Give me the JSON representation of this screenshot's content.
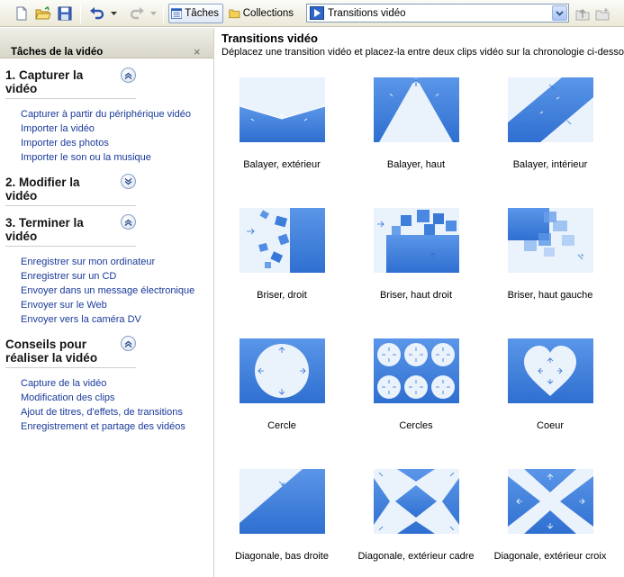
{
  "toolbar": {
    "tasks_label": "Tâches",
    "collections_label": "Collections",
    "combo_value": "Transitions vidéo"
  },
  "task_pane": {
    "title": "Tâches de la vidéo",
    "close": "×",
    "sections": [
      {
        "title_line1": "1. Capturer la",
        "title_line2": "vidéo",
        "state": "expanded",
        "links": [
          "Capturer à partir du périphérique vidéo",
          "Importer la vidéo",
          "Importer des photos",
          "Importer le son ou la musique"
        ]
      },
      {
        "title_line1": "2. Modifier la",
        "title_line2": "vidéo",
        "state": "collapsed",
        "links": []
      },
      {
        "title_line1": "3. Terminer la",
        "title_line2": "vidéo",
        "state": "expanded",
        "links": [
          "Enregistrer sur mon ordinateur",
          "Enregistrer sur un CD",
          "Envoyer dans un message électronique",
          "Envoyer sur le Web",
          "Envoyer vers la caméra DV"
        ]
      },
      {
        "title_line1": "Conseils pour",
        "title_line2": "réaliser la vidéo",
        "state": "expanded",
        "links": [
          "Capture de la vidéo",
          "Modification des clips",
          "Ajout de titres, d'effets, de transitions",
          "Enregistrement et partage des vidéos"
        ]
      }
    ]
  },
  "content": {
    "title": "Transitions vidéo",
    "description": "Déplacez une transition vidéo et placez-la entre deux clips vidéo sur la chronologie ci-dessous.",
    "transitions": [
      {
        "label": "Balayer, extérieur",
        "icon": "sweep-out-icon"
      },
      {
        "label": "Balayer, haut",
        "icon": "sweep-up-icon"
      },
      {
        "label": "Balayer, intérieur",
        "icon": "sweep-in-icon"
      },
      {
        "label": "Briser, droit",
        "icon": "shatter-right-icon"
      },
      {
        "label": "Briser, haut droit",
        "icon": "shatter-up-right-icon"
      },
      {
        "label": "Briser, haut gauche",
        "icon": "shatter-up-left-icon"
      },
      {
        "label": "Cercle",
        "icon": "circle-icon"
      },
      {
        "label": "Cercles",
        "icon": "circles-icon"
      },
      {
        "label": "Coeur",
        "icon": "heart-icon"
      },
      {
        "label": "Diagonale, bas droite",
        "icon": "diagonal-down-right-icon"
      },
      {
        "label": "Diagonale, extérieur cadre",
        "icon": "diagonal-box-out-icon"
      },
      {
        "label": "Diagonale, extérieur croix",
        "icon": "diagonal-cross-out-icon"
      }
    ]
  },
  "colors": {
    "accent_blue": "#3f7fdc",
    "light_blue": "#eaf2fc",
    "link_blue": "#1a3a9a"
  }
}
